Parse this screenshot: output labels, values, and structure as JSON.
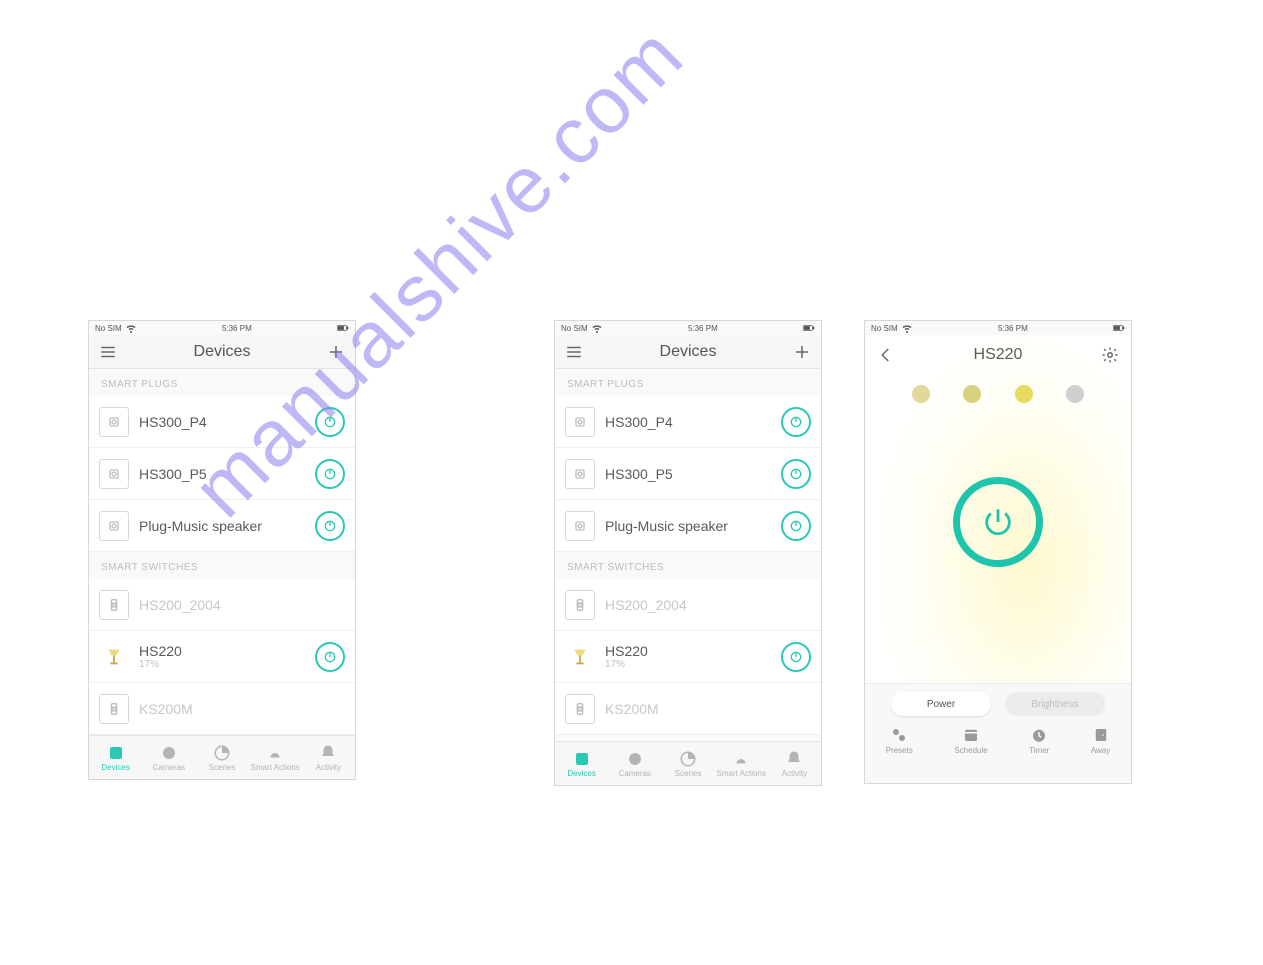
{
  "watermark": "manualshive.com",
  "status": {
    "carrier": "No SIM",
    "time": "5:36 PM"
  },
  "devicesScreen": {
    "title": "Devices",
    "section_plugs": "SMART PLUGS",
    "section_switches": "SMART SWITCHES",
    "plugs": [
      {
        "name": "HS300_P4"
      },
      {
        "name": "HS300_P5"
      },
      {
        "name": "Plug-Music speaker"
      }
    ],
    "switches": [
      {
        "name": "HS200_2004",
        "dim": true
      },
      {
        "name": "HS220",
        "sub": "17%",
        "lamp": true,
        "toggle": true
      },
      {
        "name": "KS200M",
        "dim": true
      }
    ],
    "tabs": [
      {
        "label": "Devices",
        "active": true
      },
      {
        "label": "Cameras"
      },
      {
        "label": "Scenes"
      },
      {
        "label": "Smart Actions"
      },
      {
        "label": "Activity"
      }
    ]
  },
  "detailScreen": {
    "title": "HS220",
    "pills": {
      "power": "Power",
      "brightness": "Brightness"
    },
    "tabs": [
      {
        "label": "Presets"
      },
      {
        "label": "Schedule"
      },
      {
        "label": "Timer"
      },
      {
        "label": "Away"
      }
    ]
  }
}
